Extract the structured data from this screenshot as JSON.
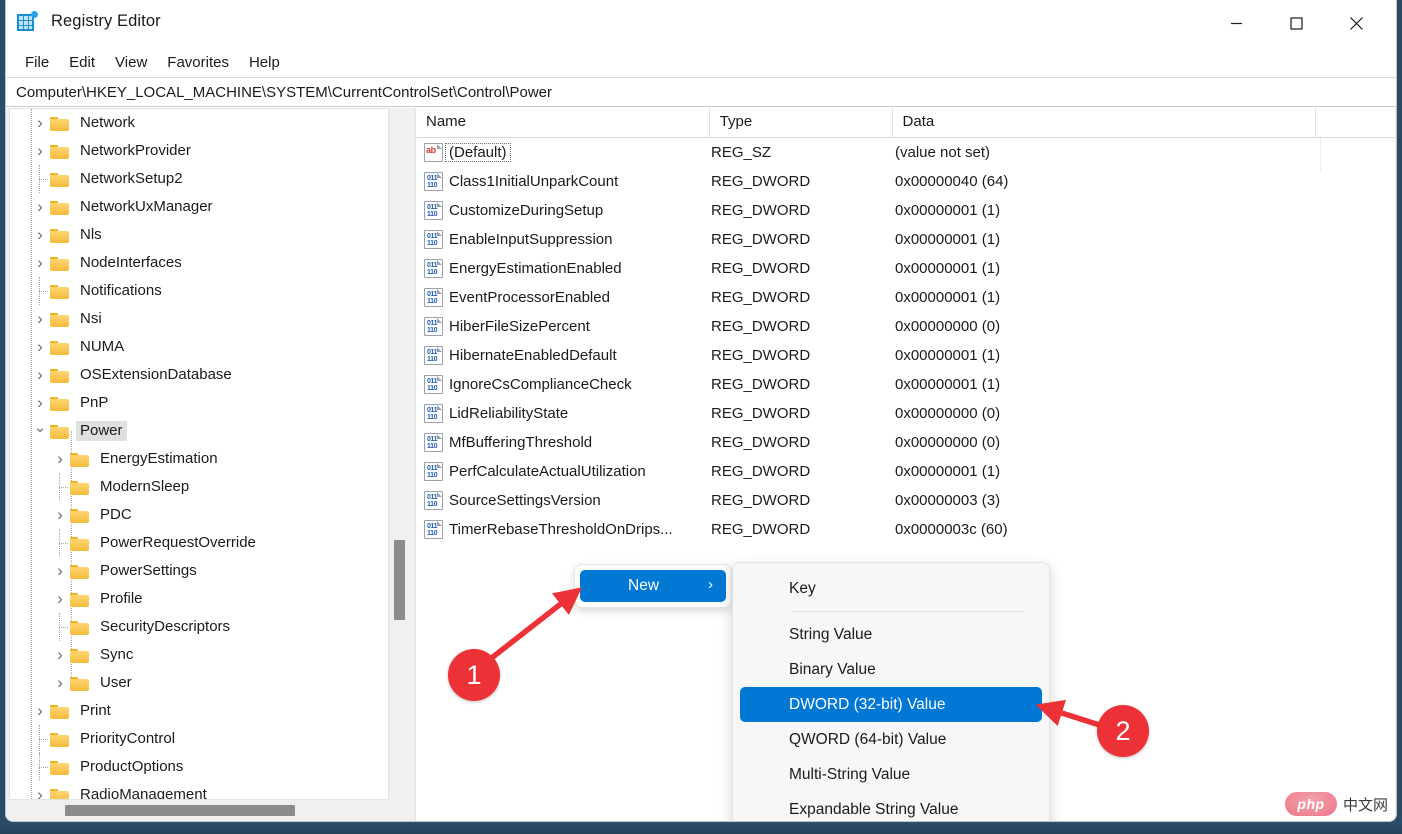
{
  "window": {
    "title": "Registry Editor",
    "icon": "registry-editor-icon",
    "controls": {
      "minimize": "—",
      "maximize": "☐",
      "close": "✕"
    }
  },
  "menubar": {
    "items": [
      {
        "label": "File"
      },
      {
        "label": "Edit"
      },
      {
        "label": "View"
      },
      {
        "label": "Favorites"
      },
      {
        "label": "Help"
      }
    ]
  },
  "address": {
    "path": "Computer\\HKEY_LOCAL_MACHINE\\SYSTEM\\CurrentControlSet\\Control\\Power"
  },
  "tree": {
    "items": [
      {
        "label": "Network",
        "indent": 1,
        "state": "closed",
        "selected": false
      },
      {
        "label": "NetworkProvider",
        "indent": 1,
        "state": "closed",
        "selected": false
      },
      {
        "label": "NetworkSetup2",
        "indent": 1,
        "state": "leaf",
        "selected": false
      },
      {
        "label": "NetworkUxManager",
        "indent": 1,
        "state": "closed",
        "selected": false
      },
      {
        "label": "Nls",
        "indent": 1,
        "state": "closed",
        "selected": false
      },
      {
        "label": "NodeInterfaces",
        "indent": 1,
        "state": "closed",
        "selected": false
      },
      {
        "label": "Notifications",
        "indent": 1,
        "state": "leaf",
        "selected": false
      },
      {
        "label": "Nsi",
        "indent": 1,
        "state": "closed",
        "selected": false
      },
      {
        "label": "NUMA",
        "indent": 1,
        "state": "closed",
        "selected": false
      },
      {
        "label": "OSExtensionDatabase",
        "indent": 1,
        "state": "closed",
        "selected": false
      },
      {
        "label": "PnP",
        "indent": 1,
        "state": "closed",
        "selected": false
      },
      {
        "label": "Power",
        "indent": 1,
        "state": "open",
        "selected": true
      },
      {
        "label": "EnergyEstimation",
        "indent": 2,
        "state": "closed",
        "selected": false
      },
      {
        "label": "ModernSleep",
        "indent": 2,
        "state": "leaf",
        "selected": false
      },
      {
        "label": "PDC",
        "indent": 2,
        "state": "closed",
        "selected": false
      },
      {
        "label": "PowerRequestOverride",
        "indent": 2,
        "state": "leaf",
        "selected": false
      },
      {
        "label": "PowerSettings",
        "indent": 2,
        "state": "closed",
        "selected": false
      },
      {
        "label": "Profile",
        "indent": 2,
        "state": "closed",
        "selected": false
      },
      {
        "label": "SecurityDescriptors",
        "indent": 2,
        "state": "leaf",
        "selected": false
      },
      {
        "label": "Sync",
        "indent": 2,
        "state": "closed",
        "selected": false
      },
      {
        "label": "User",
        "indent": 2,
        "state": "closed",
        "selected": false
      },
      {
        "label": "Print",
        "indent": 1,
        "state": "closed",
        "selected": false
      },
      {
        "label": "PriorityControl",
        "indent": 1,
        "state": "leaf",
        "selected": false
      },
      {
        "label": "ProductOptions",
        "indent": 1,
        "state": "leaf",
        "selected": false
      },
      {
        "label": "RadioManagement",
        "indent": 1,
        "state": "closed",
        "selected": false
      }
    ]
  },
  "list": {
    "columns": [
      "Name",
      "Type",
      "Data"
    ],
    "rows": [
      {
        "name": "(Default)",
        "type": "REG_SZ",
        "data": "(value not set)",
        "icon": "string-value-icon",
        "focused": true
      },
      {
        "name": "Class1InitialUnparkCount",
        "type": "REG_DWORD",
        "data": "0x00000040 (64)",
        "icon": "dword-value-icon",
        "focused": false
      },
      {
        "name": "CustomizeDuringSetup",
        "type": "REG_DWORD",
        "data": "0x00000001 (1)",
        "icon": "dword-value-icon",
        "focused": false
      },
      {
        "name": "EnableInputSuppression",
        "type": "REG_DWORD",
        "data": "0x00000001 (1)",
        "icon": "dword-value-icon",
        "focused": false
      },
      {
        "name": "EnergyEstimationEnabled",
        "type": "REG_DWORD",
        "data": "0x00000001 (1)",
        "icon": "dword-value-icon",
        "focused": false
      },
      {
        "name": "EventProcessorEnabled",
        "type": "REG_DWORD",
        "data": "0x00000001 (1)",
        "icon": "dword-value-icon",
        "focused": false
      },
      {
        "name": "HiberFileSizePercent",
        "type": "REG_DWORD",
        "data": "0x00000000 (0)",
        "icon": "dword-value-icon",
        "focused": false
      },
      {
        "name": "HibernateEnabledDefault",
        "type": "REG_DWORD",
        "data": "0x00000001 (1)",
        "icon": "dword-value-icon",
        "focused": false
      },
      {
        "name": "IgnoreCsComplianceCheck",
        "type": "REG_DWORD",
        "data": "0x00000001 (1)",
        "icon": "dword-value-icon",
        "focused": false
      },
      {
        "name": "LidReliabilityState",
        "type": "REG_DWORD",
        "data": "0x00000000 (0)",
        "icon": "dword-value-icon",
        "focused": false
      },
      {
        "name": "MfBufferingThreshold",
        "type": "REG_DWORD",
        "data": "0x00000000 (0)",
        "icon": "dword-value-icon",
        "focused": false
      },
      {
        "name": "PerfCalculateActualUtilization",
        "type": "REG_DWORD",
        "data": "0x00000001 (1)",
        "icon": "dword-value-icon",
        "focused": false
      },
      {
        "name": "SourceSettingsVersion",
        "type": "REG_DWORD",
        "data": "0x00000003 (3)",
        "icon": "dword-value-icon",
        "focused": false
      },
      {
        "name": "TimerRebaseThresholdOnDrips...",
        "type": "REG_DWORD",
        "data": "0x0000003c (60)",
        "icon": "dword-value-icon",
        "focused": false
      }
    ]
  },
  "context_menu": {
    "parent_button": {
      "label": "New",
      "chevron": "›"
    },
    "items": [
      {
        "label": "Key",
        "selected": false,
        "separator_after": true
      },
      {
        "label": "String Value",
        "selected": false,
        "separator_after": false
      },
      {
        "label": "Binary Value",
        "selected": false,
        "separator_after": false
      },
      {
        "label": "DWORD (32-bit) Value",
        "selected": true,
        "separator_after": false
      },
      {
        "label": "QWORD (64-bit) Value",
        "selected": false,
        "separator_after": false
      },
      {
        "label": "Multi-String Value",
        "selected": false,
        "separator_after": false
      },
      {
        "label": "Expandable String Value",
        "selected": false,
        "separator_after": false
      }
    ]
  },
  "annotations": {
    "badges": [
      {
        "number": "1",
        "target": "new-button"
      },
      {
        "number": "2",
        "target": "dword-32bit-value-menu-item"
      }
    ],
    "accent_color": "#ec3237"
  },
  "watermark": {
    "logo": "php",
    "text": "中文网"
  },
  "colors": {
    "accent": "#0078d4",
    "annotation": "#ec3237",
    "folder": "#f5bc3c",
    "selection_bg": "#e0e0e0",
    "desktop": "#2b4a63"
  }
}
